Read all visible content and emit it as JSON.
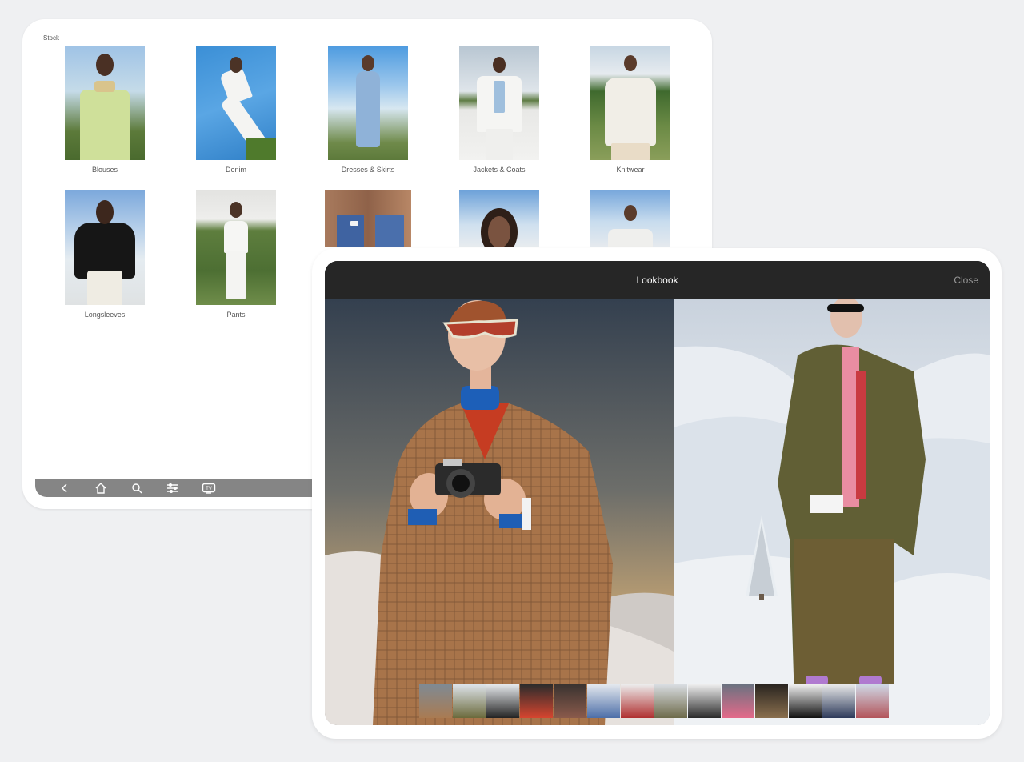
{
  "stock": {
    "label": "Stock",
    "categories": [
      {
        "label": "Blouses"
      },
      {
        "label": "Denim"
      },
      {
        "label": "Dresses & Skirts"
      },
      {
        "label": "Jackets & Coats"
      },
      {
        "label": "Knitwear"
      },
      {
        "label": "Longsleeves"
      },
      {
        "label": "Pants"
      },
      {
        "label": ""
      },
      {
        "label": ""
      },
      {
        "label": ""
      }
    ]
  },
  "toolbar": {
    "icons": [
      "back-icon",
      "home-icon",
      "search-icon",
      "filter-icon",
      "tv-icon"
    ],
    "tv_label": "TV"
  },
  "lookbook": {
    "title": "Lookbook",
    "close_label": "Close",
    "thumbnail_count": 15
  },
  "colors": {
    "page_bg": "#eff0f2",
    "header_bg": "#262626",
    "toolbar_bg": "#858585"
  }
}
